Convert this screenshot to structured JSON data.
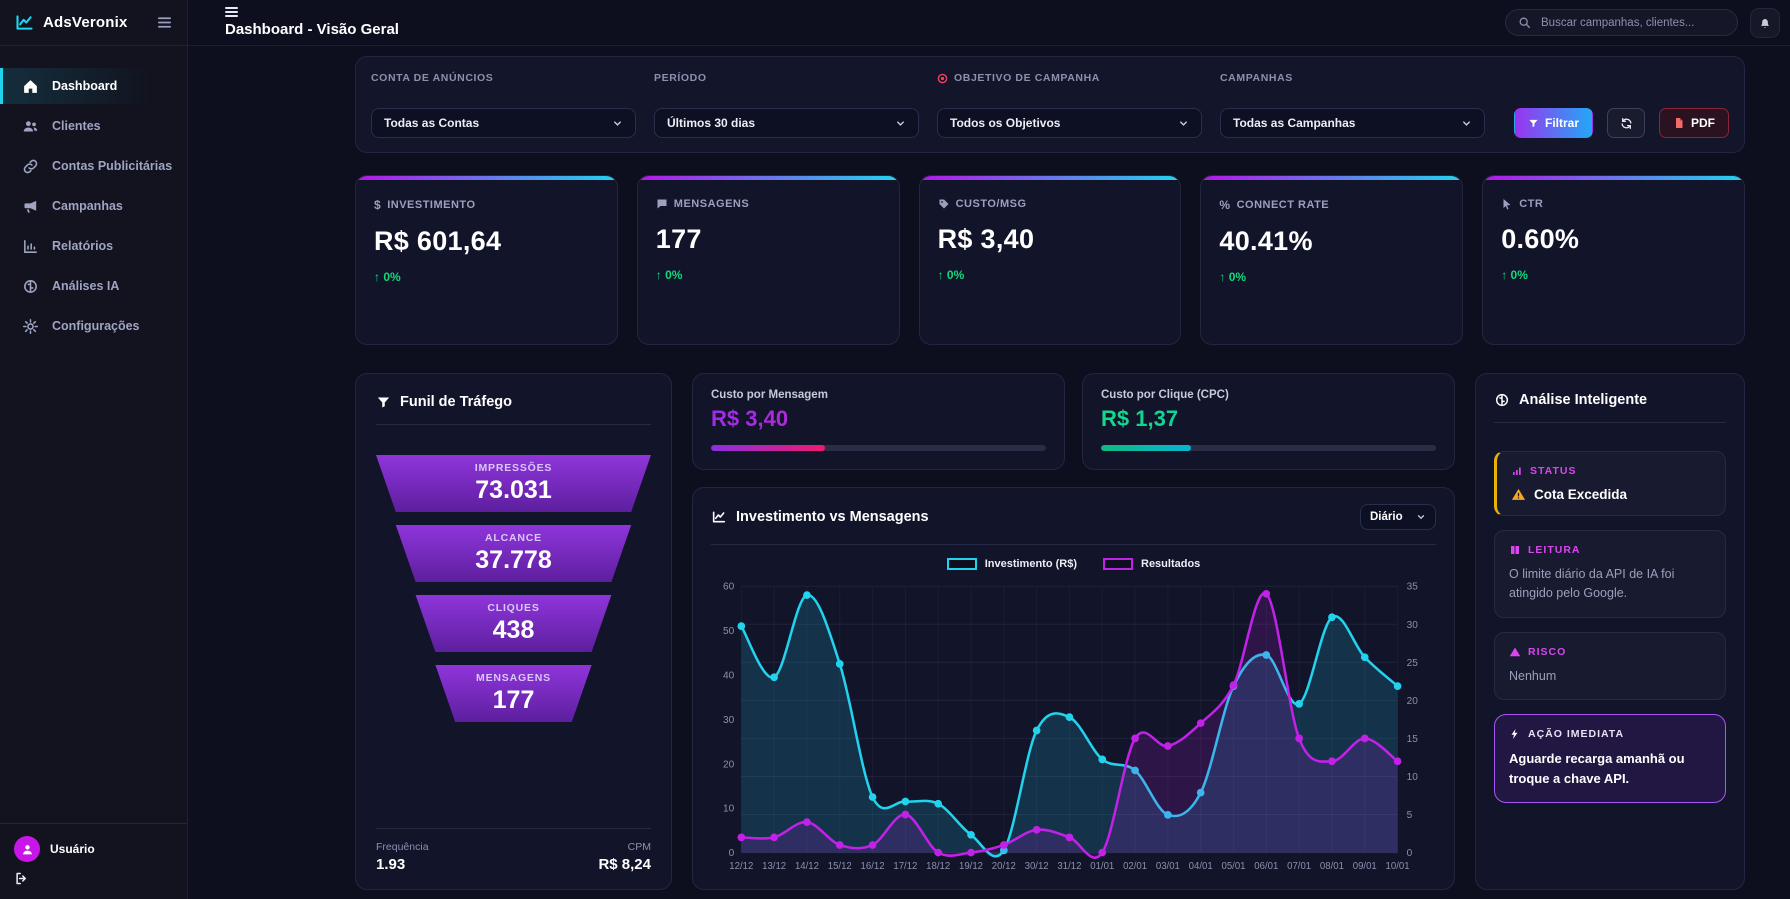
{
  "app": {
    "name": "AdsVeronix",
    "page_title": "Dashboard - Visão Geral"
  },
  "header": {
    "search_placeholder": "Buscar campanhas, clientes..."
  },
  "theme": {
    "accent_cyan": "#22d3ee",
    "accent_purple": "#b517e8",
    "positive_green": "#10d97a",
    "magenta_label": "#d946ef",
    "warning_yellow": "#eab308",
    "funnel_purple": "#8f35db"
  },
  "sidebar": {
    "items": [
      {
        "icon": "home-icon",
        "label": "Dashboard",
        "active": true
      },
      {
        "icon": "users-icon",
        "label": "Clientes",
        "active": false
      },
      {
        "icon": "link-icon",
        "label": "Contas Publicitárias",
        "active": false
      },
      {
        "icon": "megaphone-icon",
        "label": "Campanhas",
        "active": false
      },
      {
        "icon": "report-icon",
        "label": "Relatórios",
        "active": false
      },
      {
        "icon": "brain-icon",
        "label": "Análises IA",
        "active": false
      },
      {
        "icon": "gear-icon",
        "label": "Configurações",
        "active": false
      }
    ],
    "user": {
      "name": "Usuário"
    }
  },
  "filters": {
    "fields": [
      {
        "label": "CONTA DE ANÚNCIOS",
        "value": "Todas as Contas"
      },
      {
        "label": "PERÍODO",
        "value": "Últimos 30 dias"
      },
      {
        "label": "OBJETIVO DE CAMPANHA",
        "value": "Todos os Objetivos",
        "icon": "target-icon"
      },
      {
        "label": "CAMPANHAS",
        "value": "Todas as Campanhas"
      }
    ],
    "filter_button": "Filtrar",
    "pdf_button": "PDF"
  },
  "kpis": [
    {
      "icon": "dollar-icon",
      "label": "INVESTIMENTO",
      "value": "R$ 601,64",
      "delta": "↑ 0%"
    },
    {
      "icon": "chat-icon",
      "label": "MENSAGENS",
      "value": "177",
      "delta": "↑ 0%"
    },
    {
      "icon": "tag-icon",
      "label": "CUSTO/MSG",
      "value": "R$ 3,40",
      "delta": "↑ 0%"
    },
    {
      "icon": "percent-icon",
      "label": "CONNECT RATE",
      "value": "40.41%",
      "delta": "↑ 0%"
    },
    {
      "icon": "cursor-icon",
      "label": "CTR",
      "value": "0.60%",
      "delta": "↑ 0%"
    }
  ],
  "funnel": {
    "title": "Funil de Tráfego",
    "stages": [
      {
        "label": "IMPRESSÕES",
        "value": "73.031"
      },
      {
        "label": "ALCANCE",
        "value": "37.778"
      },
      {
        "label": "CLIQUES",
        "value": "438"
      },
      {
        "label": "MENSAGENS",
        "value": "177"
      }
    ],
    "footer": [
      {
        "label": "Frequência",
        "value": "1.93"
      },
      {
        "label": "CPM",
        "value": "R$ 8,24"
      }
    ]
  },
  "cost_cards": [
    {
      "label": "Custo por Mensagem",
      "value": "R$ 3,40",
      "progress_pct": 34
    },
    {
      "label": "Custo por Clique (CPC)",
      "value": "R$ 1,37",
      "progress_pct": 27
    }
  ],
  "chart_data": {
    "type": "line",
    "title": "Investimento vs Mensagens",
    "period_selector": "Diário",
    "legend_position": "top",
    "grid": true,
    "x": [
      "12/12",
      "13/12",
      "14/12",
      "15/12",
      "16/12",
      "17/12",
      "18/12",
      "19/12",
      "20/12",
      "30/12",
      "31/12",
      "01/01",
      "02/01",
      "03/01",
      "04/01",
      "05/01",
      "06/01",
      "07/01",
      "08/01",
      "09/01",
      "10/01"
    ],
    "series": [
      {
        "name": "Investimento (R$)",
        "axis": "left",
        "color": "#22d3ee",
        "values": [
          51,
          39.5,
          58,
          42.5,
          12.5,
          11.5,
          11,
          4,
          0.5,
          27.5,
          30.5,
          21,
          18.5,
          8.5,
          13.5,
          37.5,
          44.5,
          33.5,
          53,
          44,
          37.5
        ]
      },
      {
        "name": "Resultados",
        "axis": "right",
        "color": "#c221e8",
        "values": [
          2,
          2,
          4,
          1,
          1,
          5,
          0,
          0,
          1,
          3,
          2,
          0,
          15,
          14,
          17,
          22,
          34,
          15,
          12,
          15,
          12
        ]
      }
    ],
    "left_axis": {
      "min": 0,
      "max": 60,
      "step": 10
    },
    "right_axis": {
      "min": 0,
      "max": 35,
      "step": 5
    }
  },
  "insights": {
    "title": "Análise Inteligente",
    "cards": [
      {
        "icon": "signal-icon",
        "label": "STATUS",
        "text": "Cota Excedida"
      },
      {
        "icon": "book-icon",
        "label": "LEITURA",
        "text": "O limite diário da API de IA foi atingido pelo Google."
      },
      {
        "icon": "warning-icon",
        "label": "RISCO",
        "text": "Nenhum"
      },
      {
        "icon": "bolt-icon",
        "label": "AÇÃO IMEDIATA",
        "text": "Aguarde recarga amanhã ou troque a chave API."
      }
    ]
  }
}
